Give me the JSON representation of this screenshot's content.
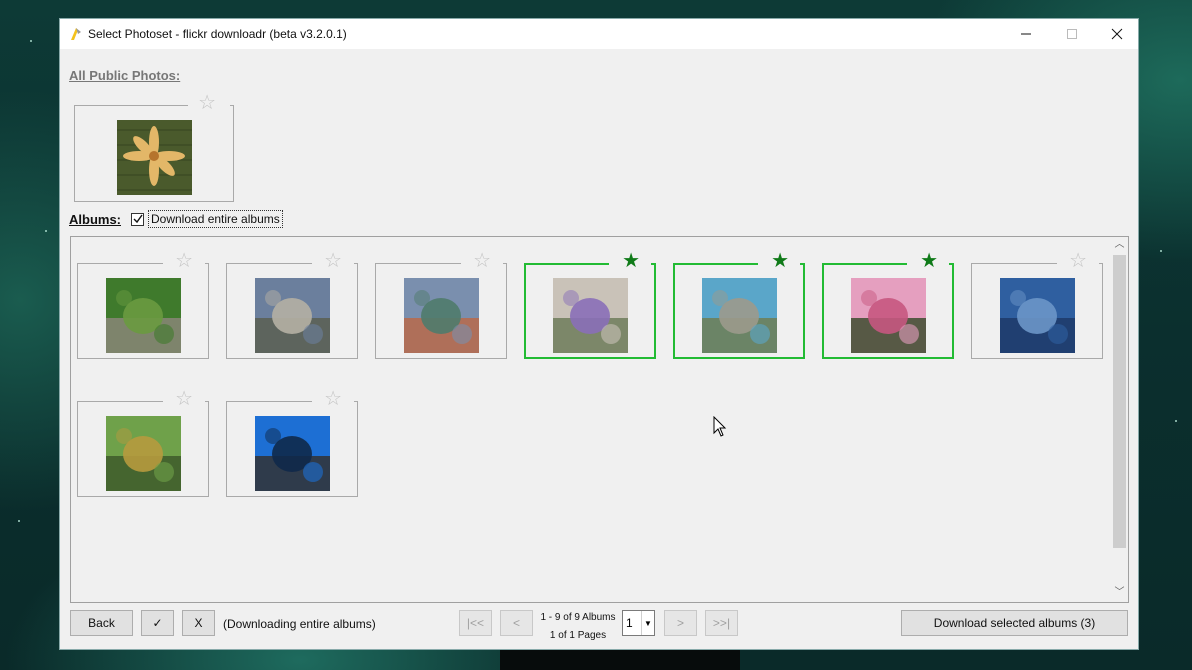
{
  "window": {
    "title": "Select Photoset - flickr downloadr (beta v3.2.0.1)"
  },
  "public_photos": {
    "label": "All Public Photos:",
    "favorited": false
  },
  "albums_section": {
    "label": "Albums:",
    "download_entire_label": "Download entire albums",
    "download_entire_checked": true
  },
  "albums": [
    {
      "id": "album-1",
      "selected": false,
      "colors": [
        "#3f7a2c",
        "#6a9a40",
        "#8a8678"
      ]
    },
    {
      "id": "album-2",
      "selected": false,
      "colors": [
        "#6b7f9d",
        "#b5b0a4",
        "#5a5f52"
      ]
    },
    {
      "id": "album-3",
      "selected": false,
      "colors": [
        "#7a8fae",
        "#4f7b6c",
        "#b96a4a"
      ]
    },
    {
      "id": "album-4",
      "selected": true,
      "colors": [
        "#c9c2b8",
        "#8a6fb8",
        "#6e7d5a"
      ]
    },
    {
      "id": "album-5",
      "selected": true,
      "colors": [
        "#5aa6c9",
        "#9c9a8c",
        "#6f7e55"
      ]
    },
    {
      "id": "album-6",
      "selected": true,
      "colors": [
        "#e59fbf",
        "#c7577f",
        "#3e4c2f"
      ]
    },
    {
      "id": "album-7",
      "selected": false,
      "colors": [
        "#2f5fa0",
        "#6c96c8",
        "#1d3a68"
      ]
    },
    {
      "id": "album-8",
      "selected": false,
      "colors": [
        "#6fa14a",
        "#b69a3e",
        "#3e5a2a"
      ]
    },
    {
      "id": "album-9",
      "selected": false,
      "colors": [
        "#1d6fd4",
        "#10294a",
        "#333"
      ]
    }
  ],
  "footer": {
    "back_label": "Back",
    "check_label": "✓",
    "x_label": "X",
    "status": "(Downloading entire albums)",
    "first_label": "|<<",
    "prev_label": "<",
    "next_label": ">",
    "last_label": ">>|",
    "range_text": "1 - 9 of 9 Albums",
    "pages_text": "1 of 1 Pages",
    "page_value": "1",
    "download_label": "Download selected albums (3)"
  },
  "colors": {
    "selected_border": "#22bb33",
    "selected_star": "#0f7a18",
    "unselected_star": "#c4c4c4"
  }
}
